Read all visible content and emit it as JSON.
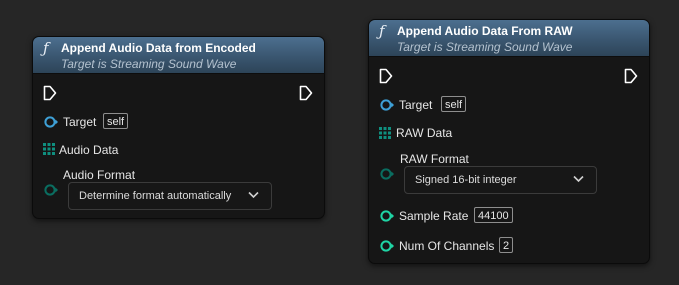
{
  "nodes": {
    "encoded": {
      "title": "Append Audio Data from Encoded",
      "subtitle": "Target is Streaming Sound Wave",
      "target_label": "Target",
      "target_value": "self",
      "audio_data_label": "Audio Data",
      "audio_format_label": "Audio Format",
      "audio_format_value": "Determine format automatically"
    },
    "raw": {
      "title": "Append Audio Data From RAW",
      "subtitle": "Target is Streaming Sound Wave",
      "target_label": "Target",
      "target_value": "self",
      "raw_data_label": "RAW Data",
      "raw_format_label": "RAW Format",
      "raw_format_value": "Signed 16-bit integer",
      "sample_rate_label": "Sample Rate",
      "sample_rate_value": "44100",
      "channels_label": "Num Of Channels",
      "channels_value": "2"
    }
  },
  "colors": {
    "background": "#262626",
    "node_body": "#161616",
    "header_blue": "#3a5670",
    "object_pin": "#3ea0d6",
    "byte_array_pin": "#0f8f7f",
    "integer_pin": "#1fd4a4",
    "enum_pin": "#0a6d60"
  },
  "icons": {
    "function": "function-icon",
    "exec_in": "exec-input-pin-icon",
    "exec_out": "exec-output-pin-icon",
    "dropdown": "chevron-down-icon"
  }
}
